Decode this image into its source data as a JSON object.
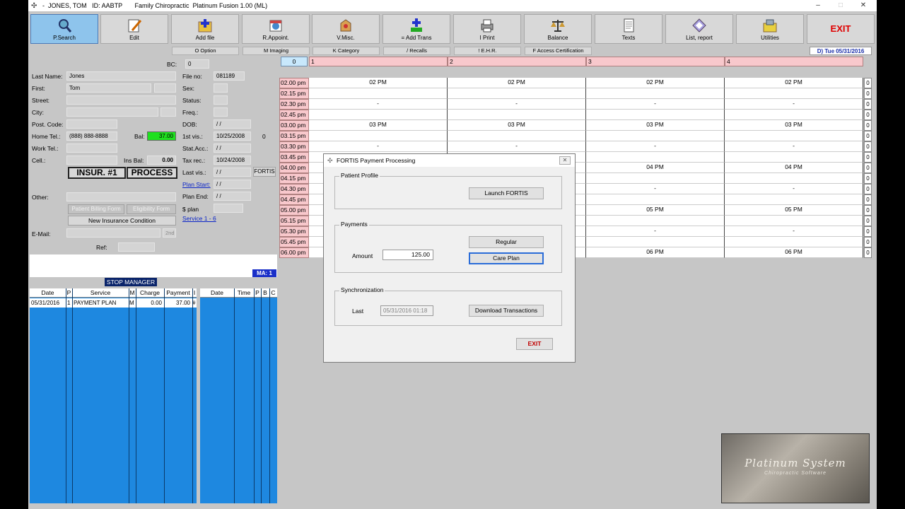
{
  "window": {
    "title": "-  JONES, TOM   ID: AABTP       Family Chiropractic  Platinum Fusion 1.00 (ML)",
    "minimize": "–",
    "maximize": "□",
    "close": "✕"
  },
  "toolbar": [
    {
      "label": "P.Search",
      "icon": "search-icon"
    },
    {
      "label": "Edit",
      "icon": "edit-icon"
    },
    {
      "label": "Add file",
      "icon": "add-file-icon"
    },
    {
      "label": "R.Appoint.",
      "icon": "appointment-icon"
    },
    {
      "label": "V.Misc.",
      "icon": "misc-icon"
    },
    {
      "label": "= Add Trans",
      "icon": "add-trans-icon"
    },
    {
      "label": "I Print",
      "icon": "print-icon"
    },
    {
      "label": "Balance",
      "icon": "balance-icon"
    },
    {
      "label": "Texts",
      "icon": "texts-icon"
    },
    {
      "label": "List, report",
      "icon": "list-report-icon"
    },
    {
      "label": "Utilities",
      "icon": "utilities-icon"
    },
    {
      "label": "EXIT",
      "icon": ""
    }
  ],
  "subbar": [
    "O Option",
    "M Imaging",
    "K Category",
    "/ Recalls",
    "! E.H.R.",
    "F Access Certification"
  ],
  "date_badge": "D)  Tue 05/31/2016",
  "patient": {
    "bc_label": "BC:",
    "bc": "0",
    "last_name_label": "Last Name:",
    "last_name": "Jones",
    "first_label": "First:",
    "first": "Tom",
    "street_label": "Street:",
    "street": "",
    "city_label": "City:",
    "post_code_label": "Post. Code:",
    "home_tel_label": "Home Tel.:",
    "home_tel": "(888) 888-8888",
    "bal_label": "Bal:",
    "bal": "37.00",
    "work_tel_label": "Work Tel.:",
    "cell_label": "Cell.:",
    "ins_bal_label": "Ins Bal:",
    "ins_bal": "0.00",
    "other_label": "Other:",
    "email_label": "E-Mail:",
    "second_label": "2nd",
    "ref_label": "Ref:",
    "file_no_label": "File no:",
    "file_no": "081189",
    "sex_label": "Sex:",
    "status_label": "Status:",
    "freq_label": "Freq.:",
    "dob_label": "DOB:",
    "dob": "/ /",
    "first_vis_label": "1st vis.:",
    "first_vis": "10/25/2008",
    "first_vis_count": "0",
    "stat_acc_label": "Stat.Acc.:",
    "stat_acc": "/ /",
    "tax_rec_label": "Tax rec.:",
    "tax_rec": "10/24/2008",
    "last_vis_label": "Last vis.:",
    "last_vis": "/ /",
    "fortis_btn": "FORTIS",
    "plan_start_label": "Plan Start:",
    "plan_start": "/ /",
    "plan_end_label": "Plan End:",
    "plan_end": "/ /",
    "s_plan_label": "$ plan",
    "service_link": "Service 1 - 6",
    "insur_btn": "INSUR. #1",
    "process_btn": "PROCESS",
    "billing_form_btn": "Patient Billing Form",
    "eligibility_btn": "Eligibility Form",
    "new_ins_btn": "New Insurance Condition"
  },
  "stop_manager": "STOP MANAGER",
  "ma_badge": "MA: 1",
  "ledger": {
    "headers": [
      "Date",
      "P",
      "Service",
      "M",
      "Charge",
      "Payment",
      "I"
    ],
    "rows": [
      [
        "05/31/2016",
        "1",
        "PAYMENT PLAN",
        "M",
        "0.00",
        "37.00",
        "#"
      ]
    ]
  },
  "appts_table": {
    "headers": [
      "Date",
      "Time",
      "P",
      "B",
      "C"
    ]
  },
  "schedule": {
    "col0": "0",
    "columns": [
      "1",
      "2",
      "3",
      "4"
    ],
    "times": [
      "02.00 pm",
      "02.15 pm",
      "02.30 pm",
      "02.45 pm",
      "03.00 pm",
      "03.15 pm",
      "03.30 pm",
      "03.45 pm",
      "04.00 pm",
      "04.15 pm",
      "04.30 pm",
      "04.45 pm",
      "05.00 pm",
      "05.15 pm",
      "05.30 pm",
      "05.45 pm",
      "06.00 pm"
    ],
    "cells": [
      [
        "02 PM",
        "02 PM",
        "02 PM",
        "02 PM"
      ],
      [
        "",
        "",
        "",
        ""
      ],
      [
        "-",
        "-",
        "-",
        "-"
      ],
      [
        "",
        "",
        "",
        ""
      ],
      [
        "03 PM",
        "03 PM",
        "03 PM",
        "03 PM"
      ],
      [
        "",
        "",
        "",
        ""
      ],
      [
        "-",
        "-",
        "-",
        "-"
      ],
      [
        "",
        "",
        "",
        ""
      ],
      [
        "",
        "",
        "04 PM",
        "04 PM"
      ],
      [
        "",
        "",
        "",
        ""
      ],
      [
        "",
        "",
        "-",
        "-"
      ],
      [
        "",
        "",
        "",
        ""
      ],
      [
        "",
        "",
        "05 PM",
        "05 PM"
      ],
      [
        "",
        "",
        "",
        ""
      ],
      [
        "",
        "",
        "-",
        "-"
      ],
      [
        "",
        "",
        "",
        ""
      ],
      [
        "",
        "",
        "06 PM",
        "06 PM"
      ]
    ],
    "counts": [
      "0",
      "0",
      "0",
      "0",
      "0",
      "0",
      "0",
      "0",
      "0",
      "0",
      "0",
      "0",
      "0",
      "0",
      "0",
      "0",
      "0"
    ]
  },
  "dialog": {
    "title": "FORTIS Payment Processing",
    "patient_profile_group": "Patient Profile",
    "launch_btn": "Launch FORTIS",
    "payments_group": "Payments",
    "amount_label": "Amount",
    "amount": "125.00",
    "regular_btn": "Regular",
    "care_plan_btn": "Care Plan",
    "sync_group": "Synchronization",
    "last_label": "Last",
    "last_value": "05/31/2016 01:18",
    "download_btn": "Download Transactions",
    "exit_btn": "EXIT"
  },
  "logo": {
    "line1": "Platinum System",
    "line2": "Chiropractic Software"
  }
}
